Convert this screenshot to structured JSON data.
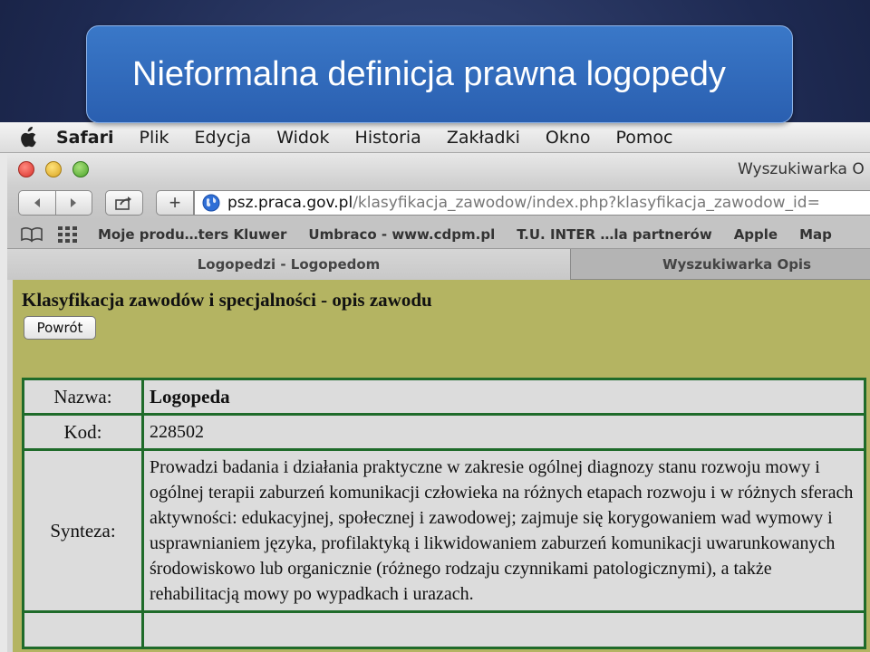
{
  "slide": {
    "title": "Nieformalna definicja prawna logopedy"
  },
  "menubar": {
    "items": [
      "Safari",
      "Plik",
      "Edycja",
      "Widok",
      "Historia",
      "Zakładki",
      "Okno",
      "Pomoc"
    ]
  },
  "window": {
    "title": "Wyszukiwarka O"
  },
  "toolbar": {
    "url_host": "psz.praca.gov.pl",
    "url_path": "/klasyfikacja_zawodow/index.php?klasyfikacja_zawodow_id="
  },
  "bookmarks": {
    "items": [
      "Moje produ…ters Kluwer",
      "Umbraco - www.cdpm.pl",
      "T.U. INTER …la partnerów",
      "Apple",
      "Map"
    ]
  },
  "tabs": [
    {
      "label": "Logopedzi - Logopedom",
      "active": true
    },
    {
      "label": "Wyszukiwarka Opis",
      "active": false
    }
  ],
  "page": {
    "heading": "Klasyfikacja zawodów i specjalności - opis zawodu",
    "back_label": "Powrót",
    "rows": [
      {
        "label": "Nazwa:",
        "value": "Logopeda"
      },
      {
        "label": "Kod:",
        "value": "228502"
      },
      {
        "label": "Synteza:",
        "value": "Prowadzi badania i działania praktyczne w zakresie ogólnej diagnozy stanu rozwoju mowy i ogólnej terapii zaburzeń komunikacji człowieka na różnych etapach rozwoju i w różnych sferach aktywności: edukacyjnej, społecznej i zawodowej; zajmuje się korygowaniem wad wymowy i usprawnianiem języka, profilaktyką i likwidowaniem zaburzeń komunikacji uwarunkowanych środowiskowo lub organicznie (różnego rodzaju czynnikami patologicznymi), a także rehabilitacją mowy po wypadkach i urazach."
      }
    ]
  },
  "colors": {
    "banner": "#2a5fb0",
    "page_bg": "#b4b462",
    "table_border": "#1f6b2a"
  }
}
